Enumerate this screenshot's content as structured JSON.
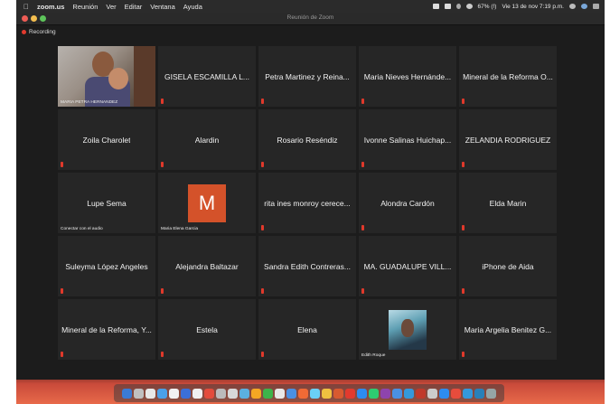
{
  "menubar": {
    "app": "zoom.us",
    "items": [
      "Reunión",
      "Ver",
      "Editar",
      "Ventana",
      "Ayuda"
    ],
    "battery": "67% (!)",
    "datetime": "Vie 13 de nov  7:19 p.m."
  },
  "window": {
    "title": "Reunión de Zoom",
    "recording_label": "Recording"
  },
  "tiles": [
    {
      "type": "video",
      "footer": "MARIA PETRA HERNANDEZ"
    },
    {
      "type": "name",
      "name": "GISELA ESCAMILLA L..."
    },
    {
      "type": "name",
      "name": "Petra Martinez y Reina..."
    },
    {
      "type": "name",
      "name": "Maria Nieves Hernánde..."
    },
    {
      "type": "name",
      "name": "Mineral de la Reforma O..."
    },
    {
      "type": "name",
      "name": "Zoila Charolet"
    },
    {
      "type": "name",
      "name": "Alardin"
    },
    {
      "type": "name",
      "name": "Rosario Reséndiz"
    },
    {
      "type": "name",
      "name": "Ivonne Salinas Huichap..."
    },
    {
      "type": "name",
      "name": "ZELANDIA RODRIGUEZ"
    },
    {
      "type": "name",
      "name": "Lupe Sema",
      "footer": "Conectar con el audio"
    },
    {
      "type": "avatar",
      "letter": "M",
      "footer": "Maria Elena Garcia"
    },
    {
      "type": "name",
      "name": "rita ines monroy cerece..."
    },
    {
      "type": "name",
      "name": "Alondra Cardón"
    },
    {
      "type": "name",
      "name": "Elda Marin"
    },
    {
      "type": "name",
      "name": "Suleyma López Angeles"
    },
    {
      "type": "name",
      "name": "Alejandra Baltazar"
    },
    {
      "type": "name",
      "name": "Sandra Edith Contreras..."
    },
    {
      "type": "name",
      "name": "MA. GUADALUPE VILL..."
    },
    {
      "type": "name",
      "name": "iPhone de Aida"
    },
    {
      "type": "name",
      "name": "Mineral de la Reforma, Y..."
    },
    {
      "type": "name",
      "name": "Estela"
    },
    {
      "type": "name",
      "name": "Elena"
    },
    {
      "type": "photo",
      "footer": "Edith Roque"
    },
    {
      "type": "name",
      "name": "Maria Argelia Benitez G..."
    }
  ],
  "colors": {
    "mute": "#e0392b",
    "avatar": "#d4522a",
    "recording": "#e23a2e"
  },
  "dock_icons": [
    "#3a7bd5",
    "#c0c0c0",
    "#e8e8e8",
    "#4aa0e8",
    "#f2f2f2",
    "#3b6fd8",
    "#f0f0f0",
    "#e34c3c",
    "#bbbbbb",
    "#d8d8d8",
    "#5bb0e0",
    "#f5a623",
    "#3db34a",
    "#e8e8e8",
    "#4a90e2",
    "#f06a35",
    "#6ad0f5",
    "#f0c040",
    "#d85a30",
    "#e23a2e",
    "#2d8cf0",
    "#2ecc71",
    "#8e44ad",
    "#4a90e2",
    "#3498db",
    "#c0392b",
    "#cccccc",
    "#2d8cf0",
    "#e74c3c",
    "#3498db",
    "#2980b9",
    "#95a5a6"
  ]
}
